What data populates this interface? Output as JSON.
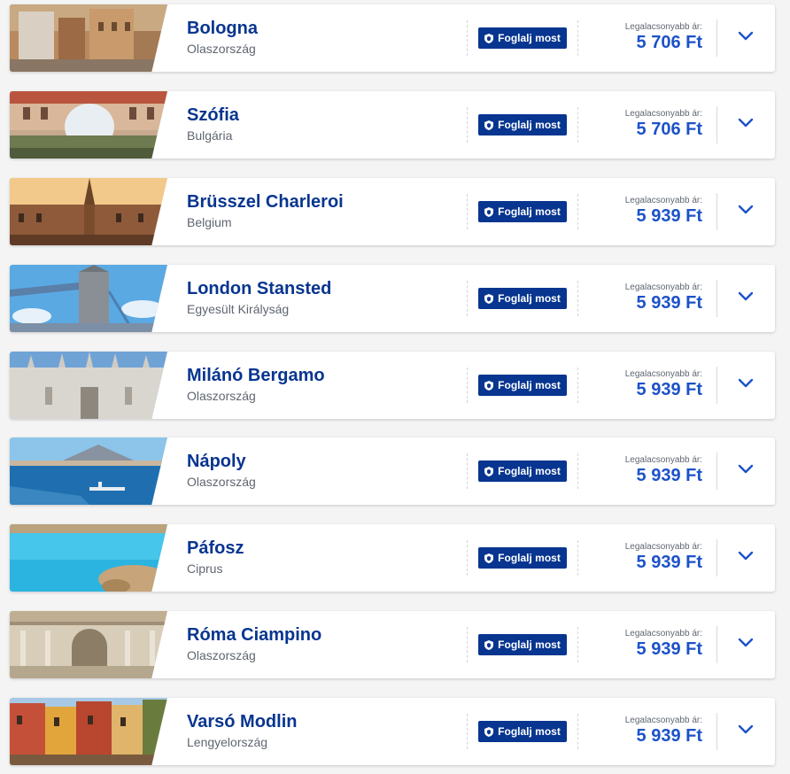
{
  "destinations": [
    {
      "city": "Bologna",
      "country": "Olaszország",
      "button": "Foglalj most",
      "price_label": "Legalacsonyabb ár:",
      "price": "5 706 Ft",
      "image": "bologna-photo"
    },
    {
      "city": "Szófia",
      "country": "Bulgária",
      "button": "Foglalj most",
      "price_label": "Legalacsonyabb ár:",
      "price": "5 706 Ft",
      "image": "sofia-photo"
    },
    {
      "city": "Brüsszel Charleroi",
      "country": "Belgium",
      "button": "Foglalj most",
      "price_label": "Legalacsonyabb ár:",
      "price": "5 939 Ft",
      "image": "brussels-photo"
    },
    {
      "city": "London Stansted",
      "country": "Egyesült Királyság",
      "button": "Foglalj most",
      "price_label": "Legalacsonyabb ár:",
      "price": "5 939 Ft",
      "image": "london-photo"
    },
    {
      "city": "Milánó Bergamo",
      "country": "Olaszország",
      "button": "Foglalj most",
      "price_label": "Legalacsonyabb ár:",
      "price": "5 939 Ft",
      "image": "milan-photo"
    },
    {
      "city": "Nápoly",
      "country": "Olaszország",
      "button": "Foglalj most",
      "price_label": "Legalacsonyabb ár:",
      "price": "5 939 Ft",
      "image": "naples-photo"
    },
    {
      "city": "Páfosz",
      "country": "Ciprus",
      "button": "Foglalj most",
      "price_label": "Legalacsonyabb ár:",
      "price": "5 939 Ft",
      "image": "paphos-photo"
    },
    {
      "city": "Róma Ciampino",
      "country": "Olaszország",
      "button": "Foglalj most",
      "price_label": "Legalacsonyabb ár:",
      "price": "5 939 Ft",
      "image": "rome-photo"
    },
    {
      "city": "Varsó Modlin",
      "country": "Lengyelország",
      "button": "Foglalj most",
      "price_label": "Legalacsonyabb ár:",
      "price": "5 939 Ft",
      "image": "warsaw-photo"
    }
  ],
  "colors": {
    "brand_blue": "#073590",
    "price_blue": "#1c52c9",
    "muted_text": "#5f6670"
  },
  "icons": {
    "book_button": "shield-icon",
    "expand": "chevron-down-icon"
  }
}
